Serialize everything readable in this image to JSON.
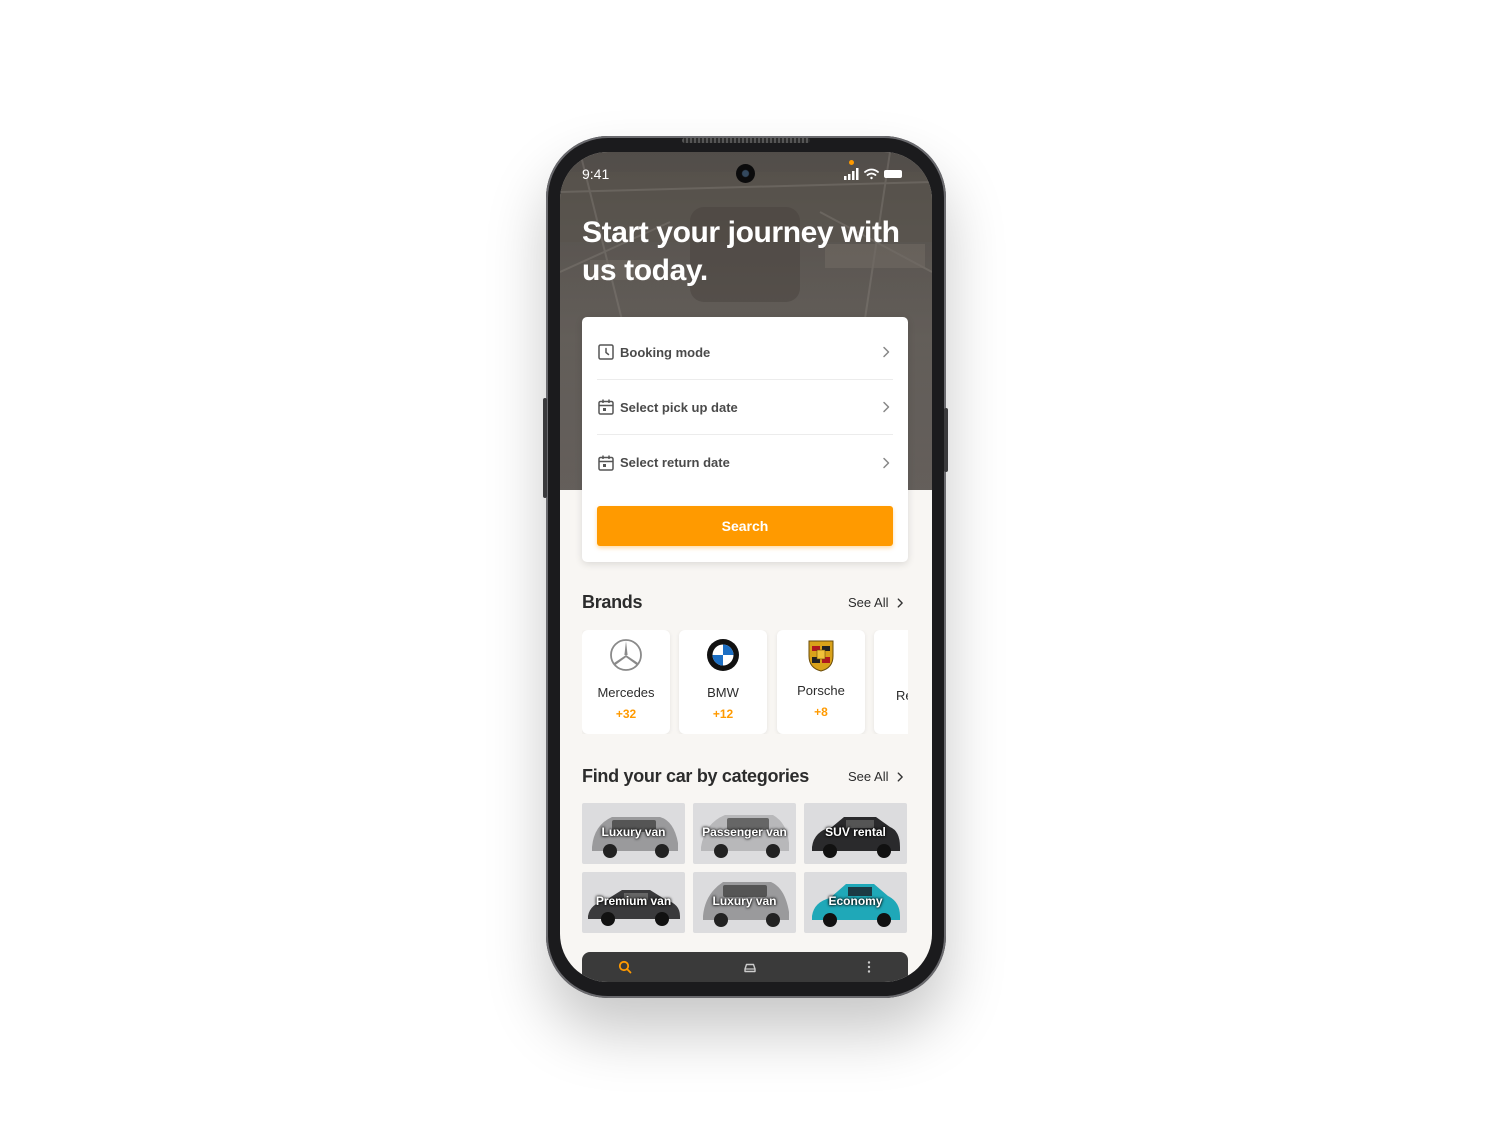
{
  "status_bar": {
    "time": "9:41"
  },
  "hero": {
    "headline": "Start your journey with us today."
  },
  "booking": {
    "rows": [
      {
        "label": "Booking mode",
        "icon": "clock-icon"
      },
      {
        "label": "Select pick up date",
        "icon": "calendar-icon"
      },
      {
        "label": "Select return date",
        "icon": "calendar-icon"
      }
    ],
    "search_label": "Search"
  },
  "brands": {
    "title": "Brands",
    "see_all": "See All",
    "items": [
      {
        "name": "Mercedes",
        "count": "+32"
      },
      {
        "name": "BMW",
        "count": "+12"
      },
      {
        "name": "Porsche",
        "count": "+8"
      },
      {
        "name": "Re",
        "count": ""
      }
    ]
  },
  "categories": {
    "title": "Find your car by categories",
    "see_all": "See All",
    "items": [
      {
        "label": "Luxury van",
        "color": "#9a9a9c"
      },
      {
        "label": "Passenger van",
        "color": "#b8b8ba"
      },
      {
        "label": "SUV rental",
        "color": "#2a2a2c"
      },
      {
        "label": "Premium van",
        "color": "#3a3a3c"
      },
      {
        "label": "Luxury van",
        "color": "#9a9a9c"
      },
      {
        "label": "Economy",
        "color": "#1fa8b8"
      }
    ]
  },
  "theme": {
    "accent": "#ff9a00",
    "nav_bg": "#3a3a3a"
  }
}
